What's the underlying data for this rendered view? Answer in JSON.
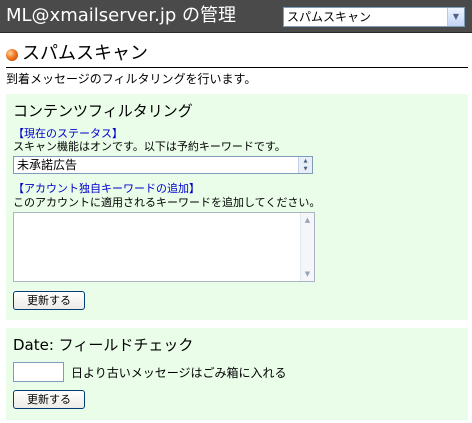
{
  "header": {
    "title": "ML@xmailserver.jp の管理",
    "module_select_value": "スパムスキャン"
  },
  "page": {
    "heading": "スパムスキャン",
    "description": "到着メッセージのフィルタリングを行います。"
  },
  "content_filter": {
    "title": "コンテンツフィルタリング",
    "status_label": "【現在のステータス】",
    "status_text": "スキャン機能はオンです。以下は予約キーワードです。",
    "keyword_selected": "未承諾広告",
    "add_keyword_label": "【アカウント独自キーワードの追加】",
    "add_keyword_desc": "このアカウントに適用されるキーワードを追加してください。",
    "keyword_textarea_value": "",
    "update_button": "更新する"
  },
  "date_check": {
    "title": "Date: フィールドチェック",
    "days_value": "",
    "days_suffix": "日より古いメッセージはごみ箱に入れる",
    "update_button": "更新する"
  },
  "icons": {
    "heading_bullet": "orange-ball-icon",
    "select_arrow": "chevron-down-icon"
  },
  "colors": {
    "titlebar_bg": "#4a4a4a",
    "panel_bg": "#e9fde9",
    "label_blue": "#0000cc",
    "bullet_orange": "#f07820"
  }
}
